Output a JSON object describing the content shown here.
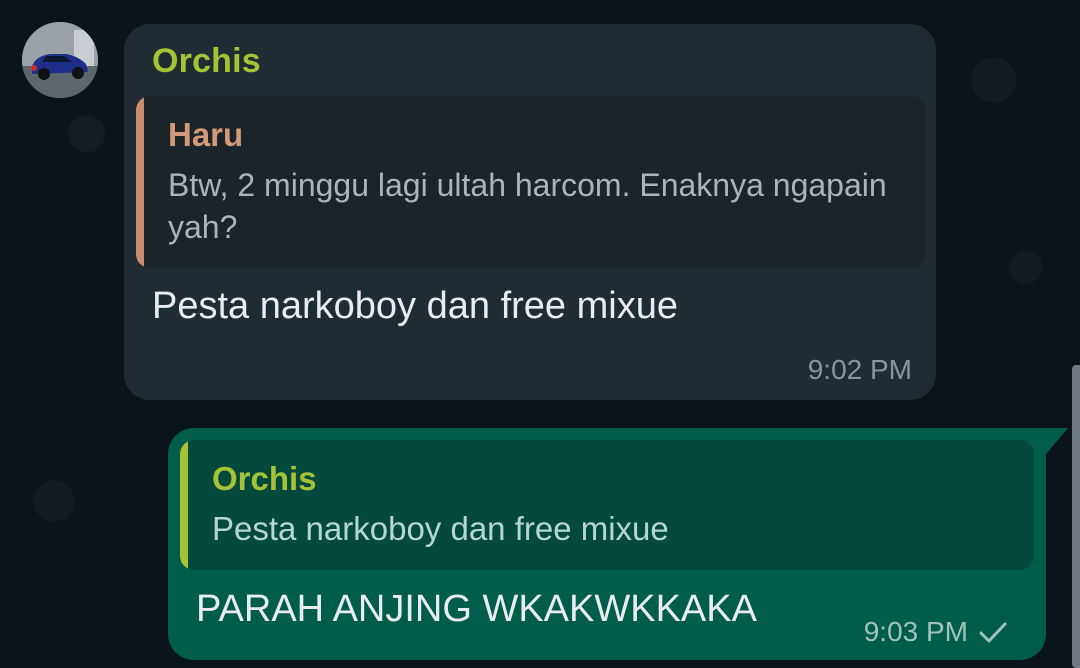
{
  "chat": {
    "incoming_message": {
      "sender": "Orchis",
      "quoted": {
        "sender": "Haru",
        "text": "Btw, 2 minggu lagi ultah harcom. Enaknya ngapain yah?"
      },
      "text": "Pesta narkoboy dan free mixue",
      "time": "9:02 PM"
    },
    "outgoing_message": {
      "quoted": {
        "sender": "Orchis",
        "text": "Pesta narkoboy dan free mixue"
      },
      "text": "PARAH ANJING WKAKWKKAKA",
      "time": "9:03 PM",
      "status_icon": "single-check-icon"
    }
  },
  "colors": {
    "background": "#0b141a",
    "incoming_bubble": "#202c33",
    "outgoing_bubble": "#005c4b",
    "sender_name": "#a6c335",
    "quoted_sender_haru": "#d39a79"
  },
  "icons": {
    "avatar": "car-photo-avatar",
    "scrollbar": "scrollbar"
  }
}
